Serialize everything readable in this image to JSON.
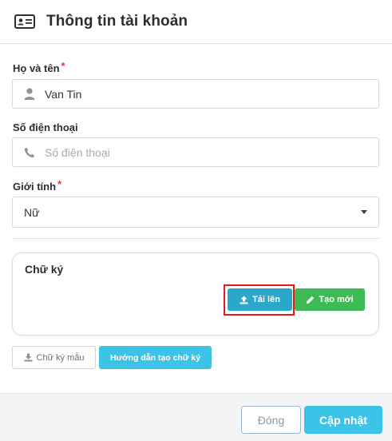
{
  "header": {
    "icon": "id-card-icon",
    "title": "Thông tin tài khoản"
  },
  "form": {
    "fullname": {
      "label": "Họ và tên",
      "required_mark": "*",
      "icon": "user-icon",
      "value": "Van Tin"
    },
    "phone": {
      "label": "Số điện thoại",
      "icon": "phone-icon",
      "value": "",
      "placeholder": "Số điện thoại"
    },
    "gender": {
      "label": "Giới tính",
      "required_mark": "*",
      "selected": "Nữ",
      "icon": "chevron-down-icon"
    }
  },
  "signature": {
    "title": "Chữ ký",
    "upload_label": "Tải lên",
    "upload_icon": "upload-icon",
    "create_label": "Tạo mới",
    "create_icon": "pencil-icon",
    "sample_label": "Chữ ký mẫu",
    "sample_icon": "download-icon",
    "guide_label": "Hướng dẫn tạo chữ ký"
  },
  "footer": {
    "close_label": "Đóng",
    "update_label": "Cập nhật"
  },
  "colors": {
    "primary": "#3cc3e7",
    "upload": "#2aa7c9",
    "create": "#3fb953",
    "required": "#e53935",
    "highlight": "#e3181c"
  }
}
